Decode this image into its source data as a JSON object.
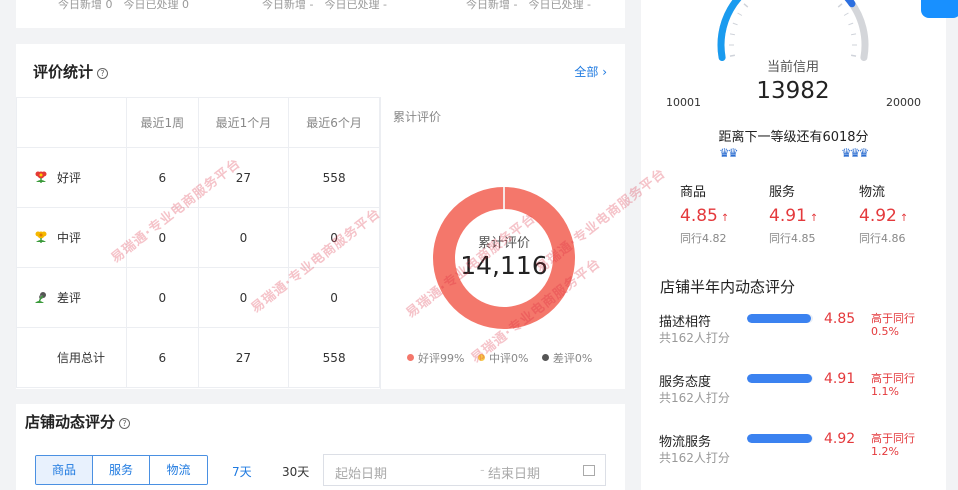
{
  "top_strip": {
    "cells": [
      {
        "text": "今日新增 0　今日已处理 0"
      },
      {
        "text": "今日新增 -　今日已处理 -"
      },
      {
        "text": "今日新增 -　今日已处理 -"
      }
    ]
  },
  "review": {
    "title": "评价统计",
    "help": "?",
    "all_link": "全部",
    "columns": [
      "最近1周",
      "最近1个月",
      "最近6个月"
    ],
    "rows": [
      {
        "label": "好评",
        "icon": "red-flower-icon",
        "values": [
          "6",
          "27",
          "558"
        ]
      },
      {
        "label": "中评",
        "icon": "yellow-flower-icon",
        "values": [
          "0",
          "0",
          "0"
        ]
      },
      {
        "label": "差评",
        "icon": "wilted-flower-icon",
        "values": [
          "0",
          "0",
          "0"
        ]
      },
      {
        "label": "信用总计",
        "icon": "",
        "values": [
          "6",
          "27",
          "558"
        ]
      }
    ],
    "cumulative_title": "累计评价",
    "donut_label": "累计评价",
    "donut_value": "14,116",
    "legend": [
      {
        "label": "好评99%",
        "color": "#f4776b"
      },
      {
        "label": "中评0%",
        "color": "#f7c948"
      },
      {
        "label": "差评0%",
        "color": "#555555"
      }
    ]
  },
  "chart_data": {
    "type": "pie",
    "title": "",
    "categories": [
      "好评",
      "中评",
      "差评"
    ],
    "values": [
      99,
      0,
      0
    ],
    "units": "%",
    "total": "14,116",
    "colors": [
      "#f4776b",
      "#f7c948",
      "#555555"
    ]
  },
  "dynamic": {
    "title": "店铺动态评分",
    "help": "?",
    "tabs": [
      {
        "label": "商品",
        "active": true
      },
      {
        "label": "服务",
        "active": false
      },
      {
        "label": "物流",
        "active": false
      }
    ],
    "ranges": [
      {
        "label": "7天",
        "active": true
      },
      {
        "label": "30天",
        "active": false
      }
    ],
    "date_start_placeholder": "起始日期",
    "date_separator": "-",
    "date_end_placeholder": "结束日期"
  },
  "credit": {
    "min": "10001",
    "max": "20000",
    "label": "当前信用",
    "value": "13982",
    "progress": 0.3964,
    "next_level": "距离下一等级还有6018分",
    "crown_left": "♛♛",
    "crown_right": "♛♛♛",
    "scores": [
      {
        "name": "商品",
        "value": "4.85",
        "arrow": "↑",
        "peer": "同行4.82"
      },
      {
        "name": "服务",
        "value": "4.91",
        "arrow": "↑",
        "peer": "同行4.85"
      },
      {
        "name": "物流",
        "value": "4.92",
        "arrow": "↑",
        "peer": "同行4.86"
      }
    ]
  },
  "half_year": {
    "title": "店铺半年内动态评分",
    "rows": [
      {
        "name": "描述相符",
        "count": "共162人打分",
        "score": "4.85",
        "fill": 0.97,
        "compare": "高于同行",
        "pct": "0.5%"
      },
      {
        "name": "服务态度",
        "count": "共162人打分",
        "score": "4.91",
        "fill": 0.98,
        "compare": "高于同行",
        "pct": "1.1%"
      },
      {
        "name": "物流服务",
        "count": "共162人打分",
        "score": "4.92",
        "fill": 0.98,
        "compare": "高于同行",
        "pct": "1.2%"
      }
    ]
  },
  "colors": {
    "accent": "#1f7ae0",
    "score_red": "#e4393c",
    "donut": "#f4776b",
    "gauge_blue": "#1a9bef",
    "gauge_grey": "#d4d6da"
  }
}
